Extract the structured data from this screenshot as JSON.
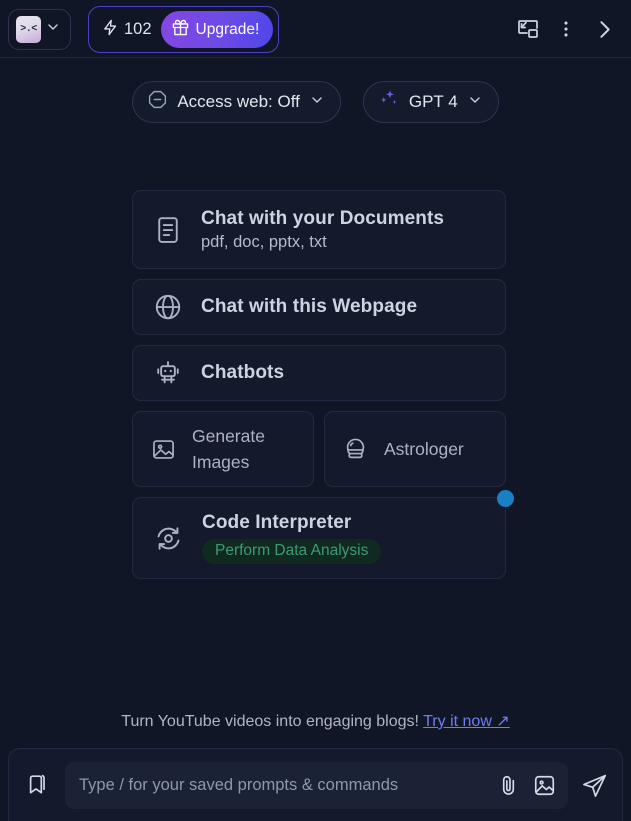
{
  "header": {
    "logo_glyph": ">.<",
    "logo_icon": "kawaii-face-logo",
    "chevron_icon": "chevron-down-icon",
    "credits": {
      "bolt_icon": "lightning-bolt-icon",
      "count": "102"
    },
    "upgrade": {
      "gift_icon": "gift-icon",
      "label": "Upgrade!"
    },
    "actions": [
      {
        "icon": "picture-in-picture-icon",
        "name": "picture-in-picture-button"
      },
      {
        "icon": "more-vertical-icon",
        "name": "more-options-button"
      },
      {
        "icon": "chevron-right-icon",
        "name": "collapse-panel-button"
      }
    ]
  },
  "selectors": [
    {
      "icon": "no-entry-icon",
      "label": "Access web: Off",
      "chevron": "chevron-down-icon"
    },
    {
      "icon": "sparkles-icon",
      "label": "GPT 4",
      "chevron": "chevron-down-icon"
    }
  ],
  "cards": {
    "documents": {
      "icon": "document-icon",
      "title": "Chat with your Documents",
      "subtitle": "pdf, doc, pptx, txt"
    },
    "webpage": {
      "icon": "globe-icon",
      "title": "Chat with this Webpage"
    },
    "chatbots": {
      "icon": "robot-icon",
      "title": "Chatbots"
    },
    "generate_images": {
      "icon": "image-icon",
      "label_line1": "Generate",
      "label_line2": "Images"
    },
    "astrologer": {
      "icon": "crystal-ball-icon",
      "label": "Astrologer"
    },
    "code_interpreter": {
      "icon": "atom-orbit-icon",
      "title": "Code Interpreter",
      "badge": "Perform Data Analysis",
      "notification_dot": "new-feature-dot"
    }
  },
  "promo": {
    "text": "Turn YouTube videos into engaging blogs!",
    "link_label": "Try it now ↗"
  },
  "input_bar": {
    "saved_prompts_icon": "bookmark-icon",
    "placeholder": "Type / for your saved prompts & commands",
    "value": "",
    "attach_icon": "paperclip-icon",
    "image_icon": "image-upload-icon",
    "send_icon": "send-icon"
  },
  "colors": {
    "background": "#101626",
    "card": "#141a2c",
    "accent_purple": "#6d4ae6",
    "badge_green": "#3d9b72",
    "link_blue": "#6d7ef0",
    "dot_blue": "#1b7fc4"
  }
}
